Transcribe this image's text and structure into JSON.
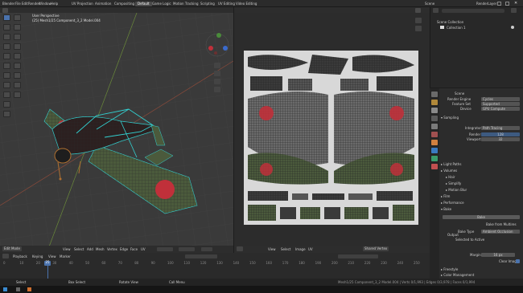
{
  "app": {
    "menu": [
      "Blender",
      "File",
      "Edit",
      "Render",
      "Window",
      "Help"
    ],
    "workspaces": [
      "UV Projection",
      "Animation",
      "Compositing",
      "Default",
      "Game Logic",
      "Motion Tracking",
      "Scripting",
      "UV Editing",
      "Video Editing"
    ],
    "active_workspace": "Default",
    "scene": "Scene",
    "layer": "RenderLayer"
  },
  "viewport": {
    "title": "User Perspective",
    "subtitle": "(25) Mesh1/25 Component_3_2 Model.004",
    "mode": "Edit Mode",
    "footer_items": [
      "View",
      "Select",
      "Add",
      "Mesh",
      "Vertex",
      "Edge",
      "Face",
      "UV"
    ]
  },
  "uv_editor": {
    "footer_items": [
      "View",
      "Select",
      "Image",
      "UV"
    ],
    "sticky_mode": "Shared Vertex"
  },
  "outliner": {
    "items": [
      "Scene Collection",
      "Collection 1"
    ]
  },
  "properties": {
    "scene_name": "Scene",
    "render_engine_label": "Render Engine",
    "render_engine": "Cycles",
    "feature_set_label": "Feature Set",
    "feature_set": "Supported",
    "device_label": "Device",
    "device": "GPU Compute",
    "sections": [
      "Sampling",
      "Light Paths",
      "Volumes",
      "Hair",
      "Simplify",
      "Motion Blur",
      "Film",
      "Performance",
      "Bake"
    ],
    "integrator_label": "Integrator",
    "integrator": "Path Tracing",
    "render_label": "Render",
    "render_value": "128",
    "viewport_label": "Viewport",
    "viewport_value": "32",
    "bake_button": "Bake",
    "bake_from_multires": "Bake from Multires",
    "bake_type_label": "Bake Type",
    "bake_type": "Ambient Occlusion",
    "output_label": "Output",
    "selected_to_active": "Selected to Active",
    "margin_label": "Margin",
    "clear_image": "Clear Image",
    "freestyle": "Freestyle",
    "color_management": "Color Management"
  },
  "timeline": {
    "header_items": [
      "Playback",
      "Keying",
      "View",
      "Marker"
    ],
    "frames": [
      "0",
      "10",
      "20",
      "30",
      "40",
      "50",
      "60",
      "70",
      "80",
      "90",
      "100",
      "110",
      "120",
      "130",
      "140",
      "150",
      "160",
      "170",
      "180",
      "190",
      "200",
      "210",
      "220",
      "230",
      "240",
      "250"
    ],
    "current_frame": "25"
  },
  "statusbar": {
    "left": "Select",
    "mid1": "Box Select",
    "mid2": "Rotate View",
    "mid3": "Call Menu",
    "right": "Mesh1/25 Component_3_2 Model.004 | Verts 0/1,993 | Edges 0/3,978 | Faces 0/1,994"
  },
  "colors": {
    "accent": "#4b73ad",
    "wire": "#32d2d2",
    "roundel": "#c0303a",
    "body_green": "#4b5a3c"
  }
}
